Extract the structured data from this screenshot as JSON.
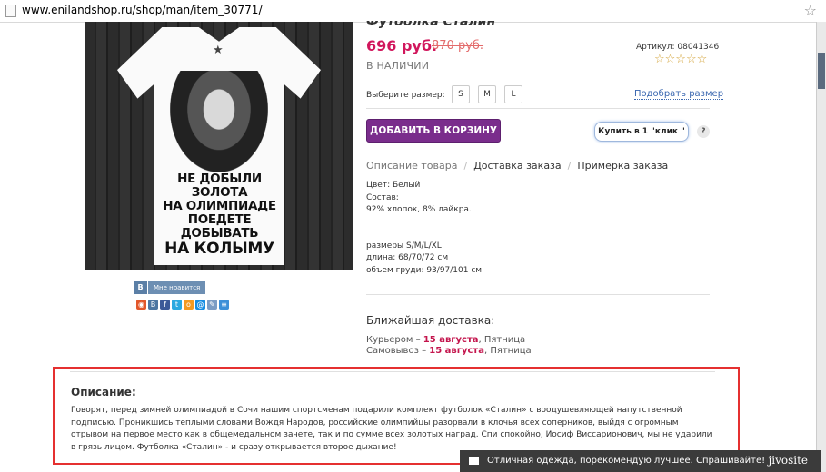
{
  "browser": {
    "url": "www.enilandshop.ru/shop/man/item_30771/"
  },
  "product": {
    "title": "Футболка Сталин",
    "price": "696 руб.",
    "old_price": "870 руб.",
    "article": "Артикул: 08041346",
    "rating_stars": "☆☆☆☆☆",
    "stock": "В НАЛИЧИИ",
    "shirt_logo": "★",
    "shirt_slogan": [
      "НЕ ДОБЫЛИ ЗОЛОТА",
      "НА ОЛИМПИАДЕ",
      "ПОЕДЕТЕ ДОБЫВАТЬ",
      "НА КОЛЫМУ"
    ]
  },
  "size": {
    "label": "Выберите размер:",
    "options": [
      "S",
      "M",
      "L"
    ],
    "pick_link": "Подобрать размер"
  },
  "buttons": {
    "add_to_cart": "ДОБАВИТЬ В КОРЗИНУ",
    "one_click": "Купить в 1 \"клик \"",
    "help": "?"
  },
  "tabs": [
    "Описание товара",
    "Доставка заказа",
    "Примерка заказа"
  ],
  "details": {
    "color": "Цвет: Белый",
    "composition_label": "Состав:",
    "composition": "92% хлопок, 8% лайкра.",
    "sizes": "размеры S/M/L/XL",
    "length": "длина: 68/70/72 см",
    "chest": "объем груди: 93/97/101 см"
  },
  "social": {
    "vk_icon": "В",
    "vk_like": "Мне нравится",
    "icons": [
      "social-icon",
      "vk-icon",
      "facebook-icon",
      "twitter-icon",
      "odnoklassniki-icon",
      "mailru-icon",
      "livejournal-icon",
      "liveinternet-icon"
    ],
    "icon_glyphs": [
      "◉",
      "В",
      "f",
      "t",
      "о",
      "@",
      "✎",
      "≡"
    ]
  },
  "delivery": {
    "title": "Ближайшая доставка:",
    "courier_label": "Курьером –",
    "courier_date": "15 августа",
    "courier_day": ", Пятница",
    "pickup_label": "Самовывоз –",
    "pickup_date": "15 августа",
    "pickup_day": ", Пятница"
  },
  "description": {
    "title": "Описание:",
    "text": "Говорят, перед зимней олимпиадой в Сочи нашим спортсменам подарили комплект футболок «Сталин» с воодушевляющей напутственной подписью. Проникшись теплыми словами Вождя Народов, российские олимпийцы разорвали в клочья всех соперников, выйдя с огромным отрывом на первое место как в общемедальном зачете, так и по сумме всех золотых наград. Спи спокойно, Иосиф Виссарионович, мы не ударили в грязь лицом. Футболка «Сталин» - и сразу открывается второе дыхание!"
  },
  "chat": {
    "message": "Отличная одежда, порекомендую лучшее. Спрашивайте!",
    "brand": "jivosite"
  },
  "colors": {
    "accent_purple": "#7a2d8c",
    "price_red": "#d1165c",
    "highlight_red": "#e53030",
    "link_blue": "#3a67b0"
  }
}
